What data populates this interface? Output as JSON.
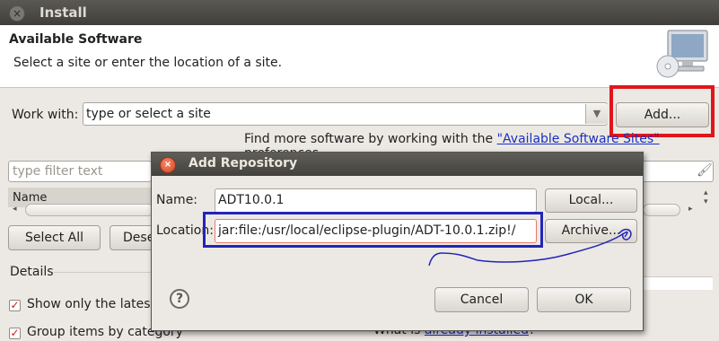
{
  "window": {
    "title": "Install"
  },
  "header": {
    "title": "Available Software",
    "description": "Select a site or enter the location of a site."
  },
  "work_with": {
    "label": "Work with:",
    "value": "type or select a site",
    "add_button": "Add..."
  },
  "find_more": {
    "prefix": "Find more software by working with the ",
    "link": "\"Available Software Sites\"",
    "suffix": " preferences."
  },
  "filter": {
    "placeholder": "type filter text"
  },
  "table": {
    "name_column": "Name"
  },
  "buttons": {
    "select_all": "Select All",
    "deselect_all": "Dese"
  },
  "details": {
    "label": "Details"
  },
  "options": {
    "show_latest": "Show only the latest",
    "group_items": "Group items by category",
    "what_prefix": "What is ",
    "what_link": "already installed",
    "what_suffix": "?"
  },
  "dialog": {
    "title": "Add Repository",
    "name_label": "Name:",
    "name_value": "ADT10.0.1",
    "local_button": "Local...",
    "location_label": "Location:",
    "location_value": "jar:file:/usr/local/eclipse-plugin/ADT-10.0.1.zip!/",
    "archive_button": "Archive...",
    "cancel_button": "Cancel",
    "ok_button": "OK"
  },
  "colors": {
    "annotation_red": "#e0161b",
    "annotation_blue": "#2224b8",
    "link": "#1a2fc2"
  },
  "icons": [
    "close-icon",
    "monitor-cd-icon",
    "chevron-down-icon",
    "clear-filter-icon",
    "help-icon",
    "checkbox-checked-icon"
  ]
}
